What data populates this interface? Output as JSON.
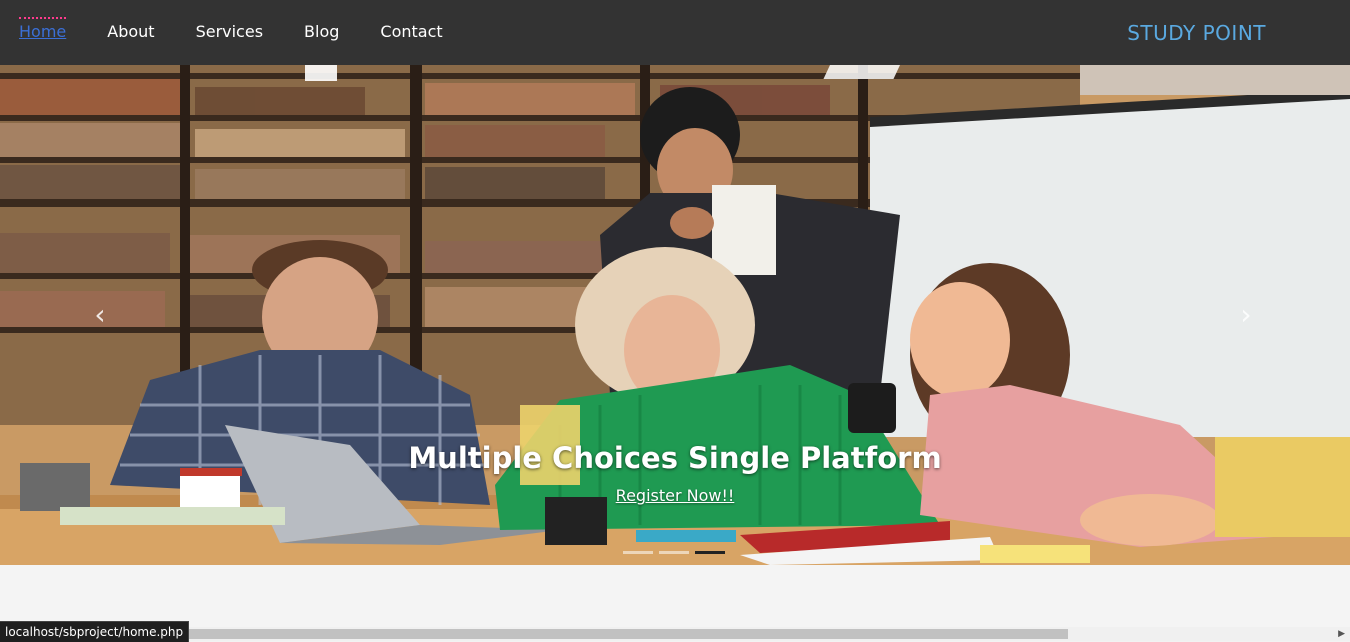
{
  "nav": {
    "links": [
      {
        "label": "Home",
        "active": true
      },
      {
        "label": "About"
      },
      {
        "label": "Services"
      },
      {
        "label": "Blog"
      },
      {
        "label": "Contact"
      }
    ],
    "brand": "STUDY POINT"
  },
  "carousel": {
    "caption_title": "Multiple Choices Single Platform",
    "caption_link": "Register Now!!",
    "prev_icon": "chevron-left-icon",
    "next_icon": "chevron-right-icon",
    "prev_glyph": "‹",
    "next_glyph": "›",
    "slide_count": 3,
    "active_slide": 3
  },
  "status_bar": {
    "url": "localhost/sbproject/home.php"
  },
  "colors": {
    "navbar_bg": "#333333",
    "brand": "#5aa9e0",
    "active_link": "#3b6fd6",
    "active_marker": "#ff3b8e"
  }
}
